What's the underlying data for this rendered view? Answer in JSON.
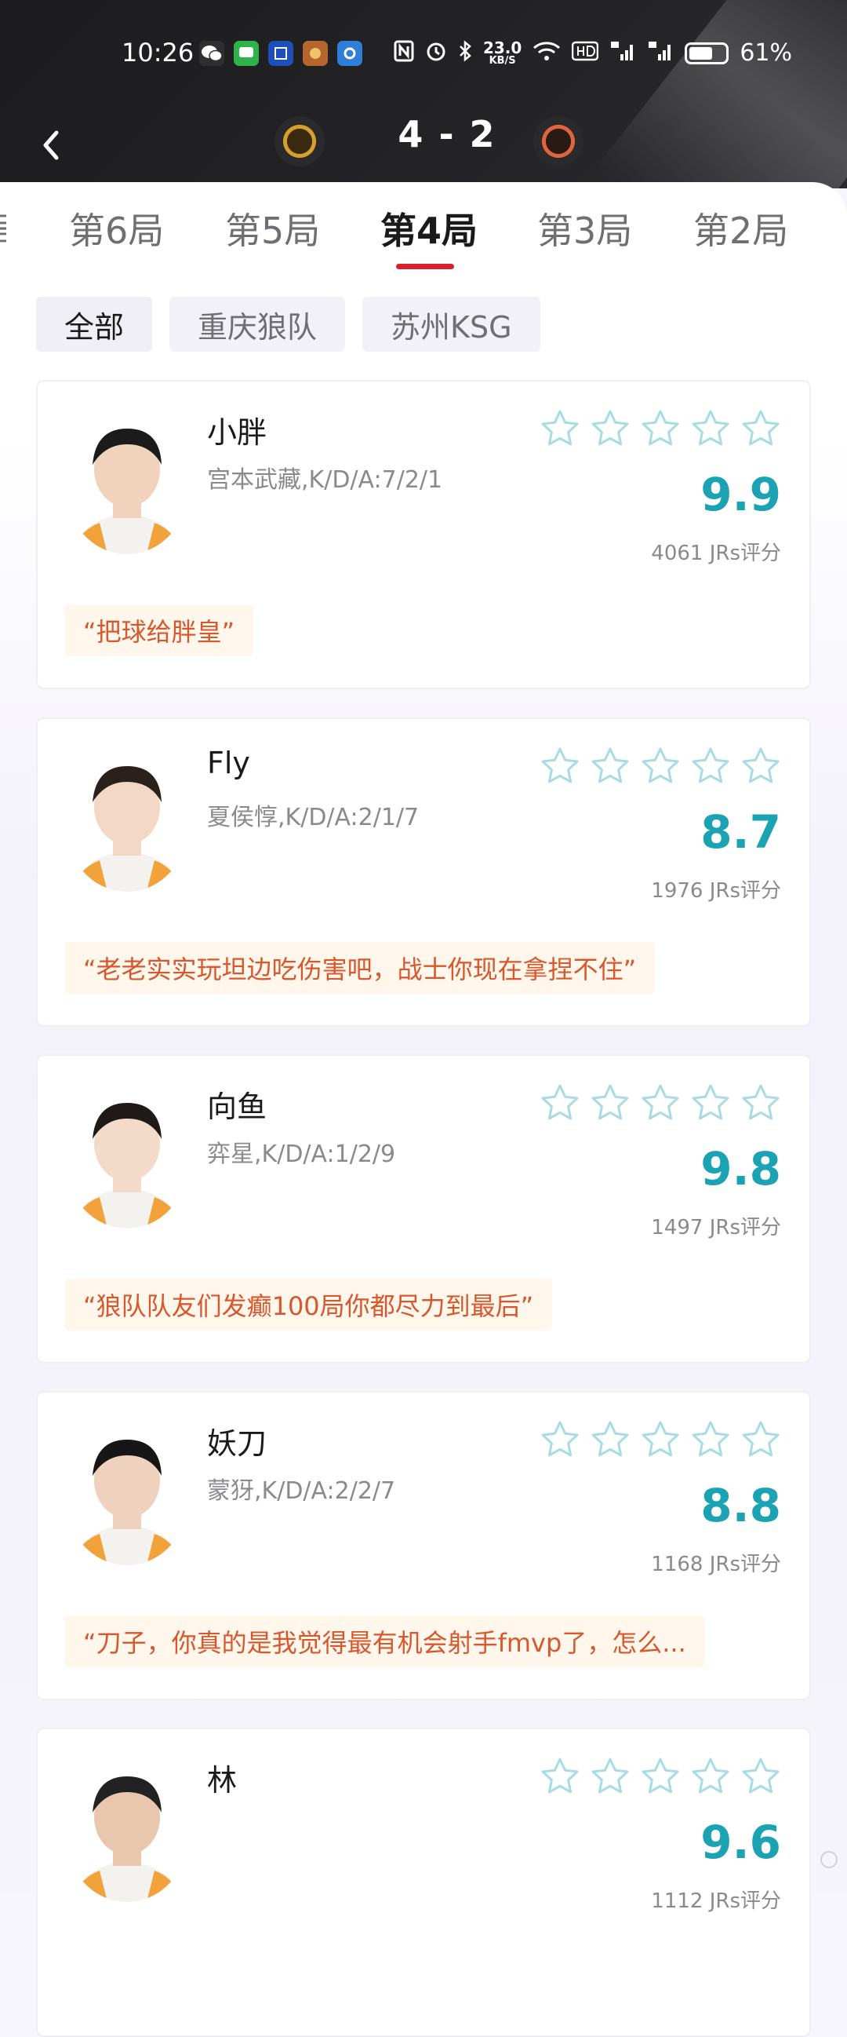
{
  "status_bar": {
    "time": "10:26",
    "net_speed_top": "23.0",
    "net_speed_unit": "KB/S",
    "battery": "61%"
  },
  "match": {
    "score": "4 - 2"
  },
  "tabs": [
    {
      "label": "第6局"
    },
    {
      "label": "第5局"
    },
    {
      "label": "第4局"
    },
    {
      "label": "第3局"
    },
    {
      "label": "第2局"
    }
  ],
  "filters": [
    {
      "label": "全部"
    },
    {
      "label": "重庆狼队"
    },
    {
      "label": "苏州KSG"
    }
  ],
  "players": [
    {
      "name": "小胖",
      "stat": "宫本武藏,K/D/A:7/2/1",
      "rating": "9.9",
      "count": "4061 JRs评分",
      "quote": "“把球给胖皇”"
    },
    {
      "name": "Fly",
      "stat": "夏侯惇,K/D/A:2/1/7",
      "rating": "8.7",
      "count": "1976 JRs评分",
      "quote": "“老老实实玩坦边吃伤害吧，战士你现在拿捏不住”"
    },
    {
      "name": "向鱼",
      "stat": "弈星,K/D/A:1/2/9",
      "rating": "9.8",
      "count": "1497 JRs评分",
      "quote": "“狼队队友们发癫100局你都尽力到最后”"
    },
    {
      "name": "妖刀",
      "stat": "蒙犽,K/D/A:2/2/7",
      "rating": "8.8",
      "count": "1168 JRs评分",
      "quote": "“刀子，你真的是我觉得最有机会射手fmvp了，怎么..."
    },
    {
      "name": "林",
      "stat": "",
      "rating": "9.6",
      "count": "1112 JRs评分",
      "quote": ""
    }
  ],
  "colors": {
    "accent_red": "#d8202f",
    "rating_teal": "#1ba3b4",
    "quote_orange": "#d9572d",
    "star_outline": "#a8dce4"
  }
}
